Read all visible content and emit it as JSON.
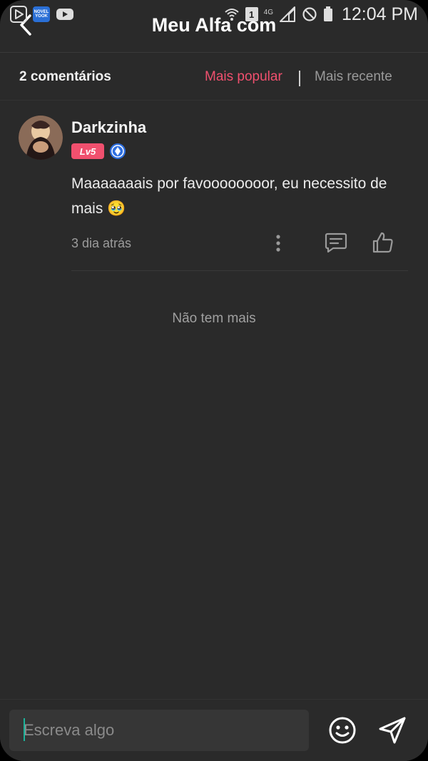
{
  "status_bar": {
    "clock": "12:04 PM",
    "network_label": "4G",
    "sim_label": "1",
    "novel_app_label": "NOVEL\nYOOK",
    "icons": [
      "play-store-icon",
      "novel-app-icon",
      "youtube-icon",
      "wifi-icon",
      "sim-icon",
      "signal-icon",
      "dnd-icon",
      "battery-icon"
    ]
  },
  "header": {
    "title": "Meu Alfa com",
    "back_icon": "chevron-left-icon"
  },
  "comments_bar": {
    "count_label": "2 comentários",
    "sort_popular": "Mais popular",
    "sort_recent": "Mais recente",
    "active_sort": "popular"
  },
  "comments": [
    {
      "username": "Darkzinha",
      "level": "Lv5",
      "text": "Maaaaaaais por favoooooooor, eu necessito de mais 🥹",
      "time": "3 dia atrás"
    }
  ],
  "no_more_label": "Não tem mais",
  "composer": {
    "placeholder": "Escreva algo"
  },
  "colors": {
    "background": "#2a2a2a",
    "accent": "#f0506e",
    "text": "#f4f4f4",
    "muted": "#9c9c9c",
    "medal": "#2e6fe0",
    "caret": "#1bb39a"
  }
}
